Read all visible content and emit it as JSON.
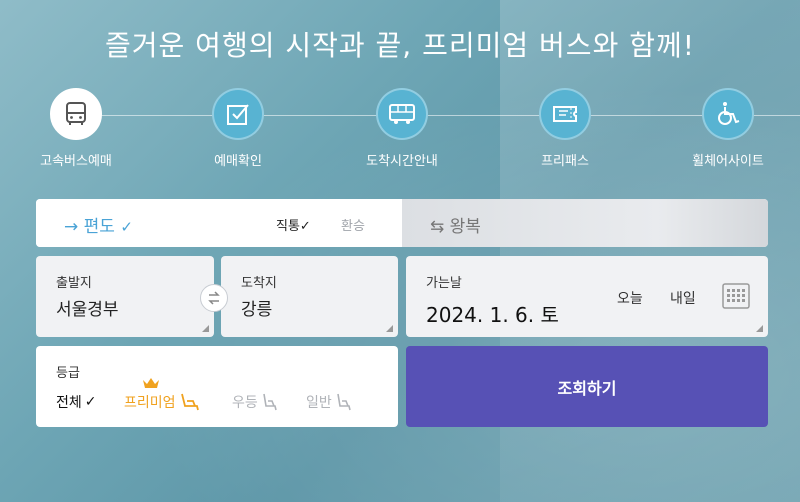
{
  "headline": "즐거운 여행의 시작과 끝, 프리미엄 버스와 함께!",
  "menu": [
    {
      "label": "고속버스예매",
      "icon": "bus-icon"
    },
    {
      "label": "예매확인",
      "icon": "checkbox-icon"
    },
    {
      "label": "도착시간안내",
      "icon": "bus-schedule-icon"
    },
    {
      "label": "프리패스",
      "icon": "ticket-icon"
    },
    {
      "label": "휠체어사이트",
      "icon": "wheelchair-icon"
    }
  ],
  "trip": {
    "oneway_label": "편도",
    "direct_label": "직통",
    "transfer_label": "환승",
    "round_label": "왕복"
  },
  "departure": {
    "label": "출발지",
    "value": "서울경부"
  },
  "arrival": {
    "label": "도착지",
    "value": "강릉"
  },
  "date": {
    "label": "가는날",
    "value": "2024. 1. 6. 토",
    "today": "오늘",
    "tomorrow": "내일"
  },
  "grade": {
    "label": "등급",
    "all": "전체",
    "premium": "프리미엄",
    "excellent": "우등",
    "general": "일반"
  },
  "search_label": "조회하기",
  "colors": {
    "accent": "#4aa3d6",
    "premium": "#f0a21f",
    "search": "#5751b5"
  }
}
